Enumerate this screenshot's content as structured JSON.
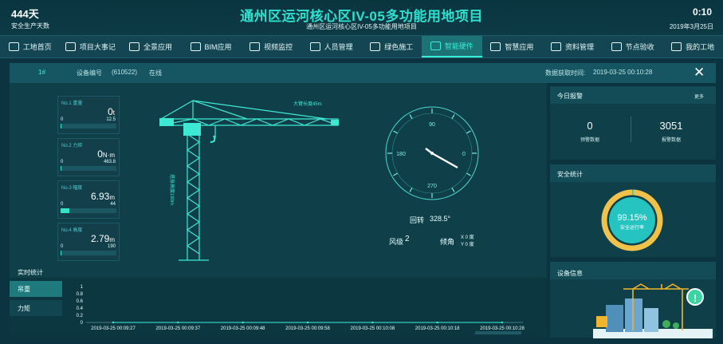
{
  "header": {
    "safe_days": "444天",
    "safe_days_label": "安全生产天数",
    "title": "通州区运河核心区IV-05多功能用地项目",
    "subtitle": "通州区运河核心区IV-05多功能用地项目",
    "time": "0:10",
    "date": "2019年3月25日"
  },
  "nav": [
    {
      "label": "工地首页",
      "icon": "grid-icon"
    },
    {
      "label": "项目大事记",
      "icon": "list-icon"
    },
    {
      "label": "全景应用",
      "icon": "monitor-icon"
    },
    {
      "label": "BIM应用",
      "icon": "cube-icon"
    },
    {
      "label": "视频监控",
      "icon": "camera-icon"
    },
    {
      "label": "人员管理",
      "icon": "person-icon"
    },
    {
      "label": "绿色施工",
      "icon": "leaf-icon"
    },
    {
      "label": "智能硬件",
      "icon": "chip-icon",
      "active": true
    },
    {
      "label": "智慧应用",
      "icon": "gear-icon"
    },
    {
      "label": "资料管理",
      "icon": "folder-icon"
    },
    {
      "label": "节点验收",
      "icon": "check-icon"
    },
    {
      "label": "我的工地",
      "icon": "user-icon"
    }
  ],
  "device_bar": {
    "number": "1#",
    "device_code_label": "设备编号",
    "device_code": "(610522)",
    "status": "在线",
    "fetch_time_label": "数据获取时间:",
    "fetch_time": "2019-03-25 00:10:28"
  },
  "gauges": [
    {
      "label": "No.1 重量",
      "value": "0",
      "unit": "t",
      "min": "0",
      "max": "12.5",
      "fill_fraction": 0.0
    },
    {
      "label": "No.2 力矩",
      "value": "0",
      "unit": "N·m",
      "min": "0",
      "max": "463.8",
      "fill_fraction": 0.0
    },
    {
      "label": "No.3 幅度",
      "value": "6.93",
      "unit": "m",
      "min": "0",
      "max": "44",
      "fill_fraction": 0.157
    },
    {
      "label": "No.4 高度",
      "value": "2.79",
      "unit": "m",
      "min": "0",
      "max": "190",
      "fill_fraction": 0.015
    }
  ],
  "crane": {
    "jib_label": "大臂长度45m",
    "tower_label": "塔身高度190m"
  },
  "compass": {
    "n": "90",
    "e": "0",
    "s": "270",
    "w": "180",
    "rotate_label": "回转",
    "rotate_value": "328.5°",
    "wind_label": "风级",
    "wind_value": "2",
    "tilt_label": "倾角",
    "tilt_x": "X 0 度",
    "tilt_y": "Y 0 度"
  },
  "realtime": {
    "title": "实时统计",
    "tabs": [
      "吊重",
      "力矩"
    ]
  },
  "chart_data": {
    "type": "line",
    "title": "",
    "x": [
      "2019-03-25 00:09:27",
      "2019-03-25 00:09:37",
      "2019-03-25 00:09:48",
      "2019-03-25 00:09:58",
      "2019-03-25 00:10:08",
      "2019-03-25 00:10:18",
      "2019-03-25 00:10:28"
    ],
    "series": [
      {
        "values": [
          0,
          0,
          0,
          0,
          0,
          0,
          0
        ]
      }
    ],
    "y_ticks": [
      "1",
      "0.8",
      "0.6",
      "0.4",
      "0.2",
      "0"
    ],
    "ylim": [
      0,
      1
    ]
  },
  "alarm": {
    "title": "今日报警",
    "more": "更多",
    "warn_value": "0",
    "warn_label": "预警数据",
    "alarm_value": "3051",
    "alarm_label": "报警数据"
  },
  "safety": {
    "title": "安全统计",
    "rate": "99.15%",
    "rate_fraction": 0.9915,
    "rate_label": "安全运行率"
  },
  "device_info": {
    "title": "设备信息",
    "alert_icon": "!"
  },
  "colors": {
    "accent": "#3cf0d8",
    "donut_ring": "#f1c24a",
    "donut_fill": "#2bd4c8"
  }
}
